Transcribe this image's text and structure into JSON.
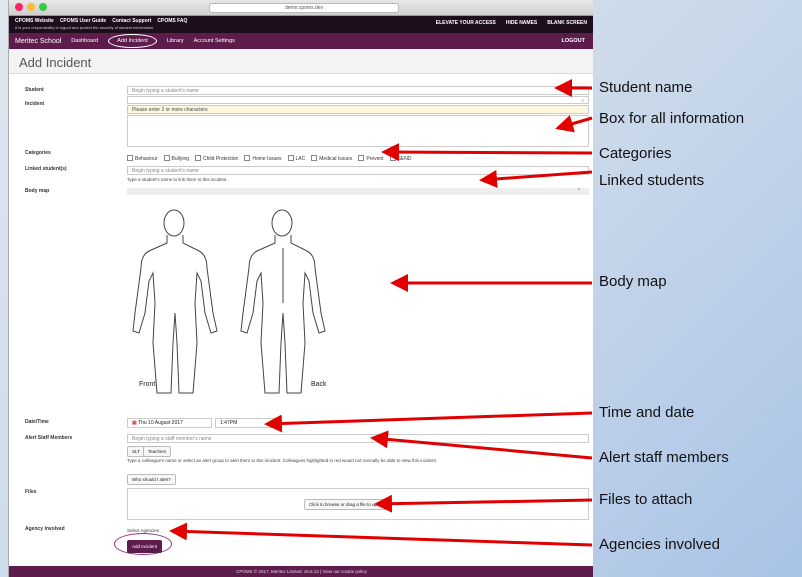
{
  "browser": {
    "url": "demo.cpoms.dev"
  },
  "topbar": {
    "links": [
      "CPOMS Website",
      "CPOMS User Guide",
      "Contact Support",
      "CPOMS FAQ"
    ],
    "note": "It is your responsibility to logout and protect the security of student information.",
    "right": [
      "ELEVATE YOUR ACCESS",
      "HIDE NAMES",
      "BLANK SCREEN"
    ]
  },
  "nav": {
    "brand": "Meritec School",
    "items": [
      "Dashboard",
      "Add Incident",
      "Library",
      "Account Settings"
    ],
    "logout": "LOGOUT"
  },
  "page_title": "Add Incident",
  "form": {
    "student_label": "Student",
    "student_placeholder": "Begin typing a student's name",
    "student_hint": "Please enter 2 or more characters",
    "incident_label": "Incident",
    "categories_label": "Categories",
    "categories": [
      "Behaviour",
      "Bullying",
      "Child Protection",
      "Home Issues",
      "LAC",
      "Medical Issues",
      "Prevent",
      "SEND"
    ],
    "linked_label": "Linked student(s)",
    "linked_placeholder": "Begin typing a student's name",
    "linked_hint": "Type a student's name to link them to this incident.",
    "bodymap_label": "Body map",
    "front_label": "Front",
    "back_label": "Back",
    "datetime_label": "Date/Time",
    "date_value": "Thu 10 August 2017",
    "time_value": "1:47PM",
    "alert_label": "Alert Staff Members",
    "alert_placeholder": "Begin typing a staff member's name",
    "alert_groups": [
      "SLT",
      "Teachers"
    ],
    "alert_hint": "Type a colleague's name or select an alert group to alert them to this incident. Colleagues highlighted in red would not normally be able to view this incident.",
    "who_alert": "Who should I alert?",
    "files_label": "Files",
    "files_button": "Click to browse or drag a file to upload",
    "agency_label": "Agency Involved",
    "agency_link": "Select Agencies",
    "submit": "Add Incident"
  },
  "footer": "CPOMS © 2017, Meritec Limited. v6.5.12 | View our cookie policy",
  "annotations": [
    "Student name",
    "Box for all information",
    "Categories",
    "Linked students",
    "Body map",
    "Time and date",
    "Alert staff members",
    "Files to attach",
    "Agencies involved"
  ],
  "colors": {
    "nav": "#5e1c4c",
    "topbar": "#1e0d1c",
    "arrow": "#e00000"
  }
}
